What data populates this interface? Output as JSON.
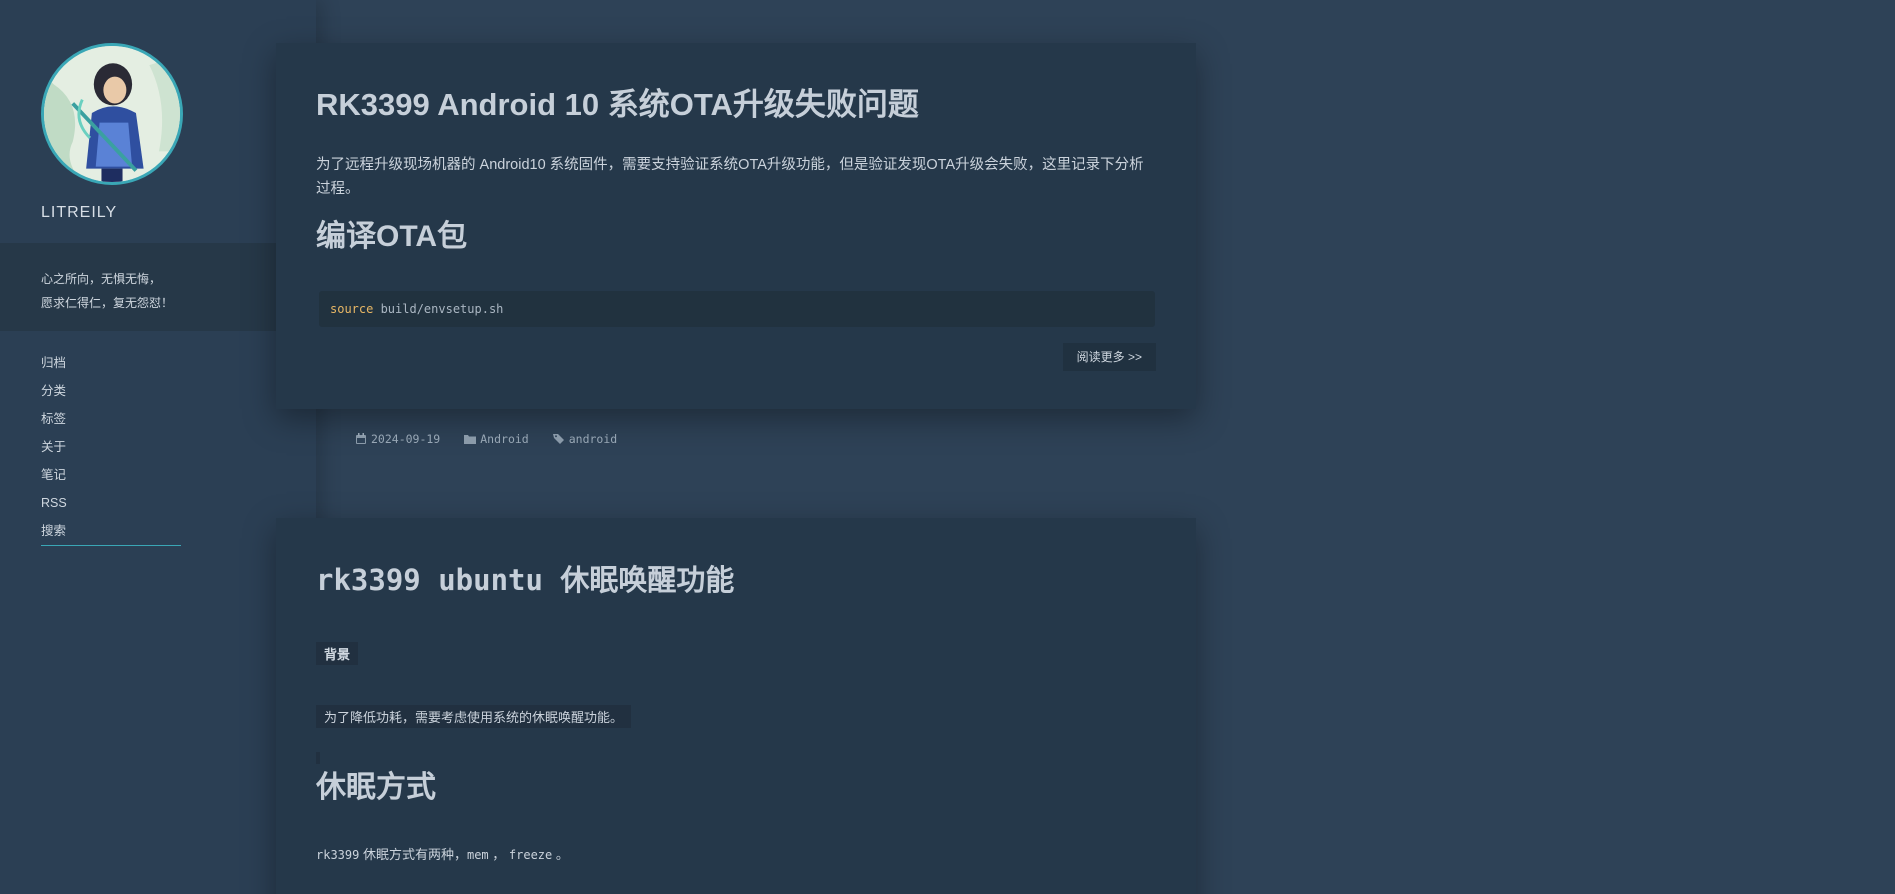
{
  "sidebar": {
    "site_name": "LITREILY",
    "motto_line1": "心之所向，无惧无悔，",
    "motto_line2": "愿求仁得仁，复无怨怼！",
    "nav": [
      {
        "label": "归档"
      },
      {
        "label": "分类"
      },
      {
        "label": "标签"
      },
      {
        "label": "关于"
      },
      {
        "label": "笔记"
      },
      {
        "label": "RSS"
      },
      {
        "label": "搜索"
      }
    ]
  },
  "posts": [
    {
      "title": "RK3399 Android 10 系统OTA升级失败问题",
      "excerpt": "为了远程升级现场机器的 Android10 系统固件，需要支持验证系统OTA升级功能，但是验证发现OTA升级会失败，这里记录下分析过程。",
      "heading": "编译OTA包",
      "code_keyword": "source",
      "code_rest": " build/envsetup.sh",
      "read_more": "阅读更多 >>",
      "meta": {
        "date": "2024-09-19",
        "category": "Android",
        "tag": "android"
      }
    },
    {
      "title": "rk3399 ubuntu 休眠唤醒功能",
      "label_background": "背景",
      "paragraph": "为了降低功耗，需要考虑使用系统的休眠唤醒功能。",
      "heading": "休眠方式",
      "line_prefix": "rk3399",
      "line_text": " 休眠方式有两种，",
      "code1": "mem",
      "sep": " ， ",
      "code2": "freeze",
      "end": " 。"
    }
  ],
  "colors": {
    "background": "#2e4257",
    "sidebar": "#2b3f54",
    "card": "#25384a",
    "accent": "#3aa7b6",
    "code_keyword": "#e8b765"
  }
}
